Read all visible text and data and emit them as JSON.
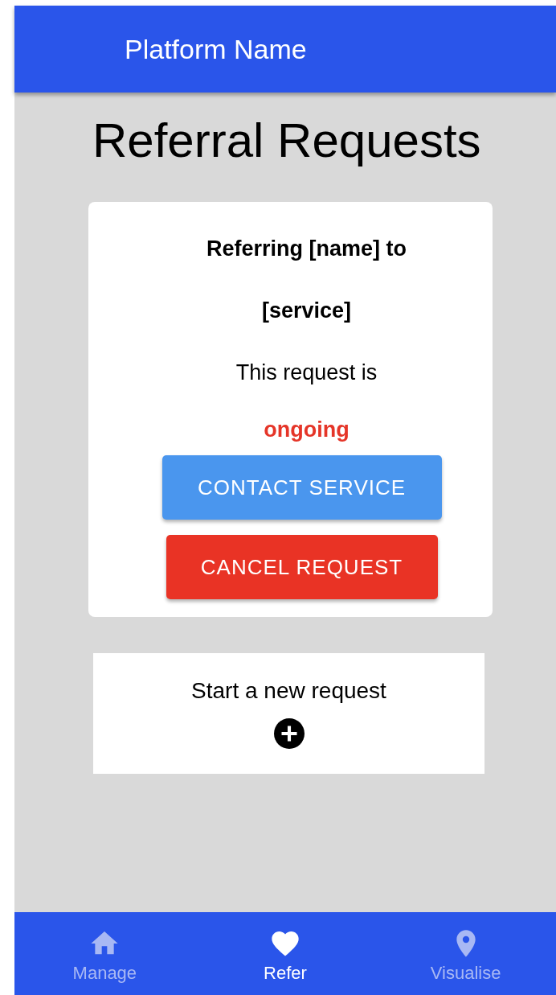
{
  "app_bar": {
    "title": "Platform Name"
  },
  "page_title": "Referral Requests",
  "requests": [
    {
      "title": "Referring [name] to [service]",
      "status_label": "This request is",
      "status": "ongoing",
      "buttons": [
        {
          "label": "CONTACT SERVICE",
          "kind": "primary"
        },
        {
          "label": "CANCEL REQUEST",
          "kind": "danger"
        }
      ]
    }
  ],
  "new_request": {
    "label": "Start a new request"
  },
  "bottom_nav": [
    {
      "label": "Manage",
      "kind": "home",
      "selected": false
    },
    {
      "label": "Refer",
      "kind": "heart",
      "selected": true
    },
    {
      "label": "Visualise",
      "kind": "pin",
      "selected": false
    }
  ]
}
